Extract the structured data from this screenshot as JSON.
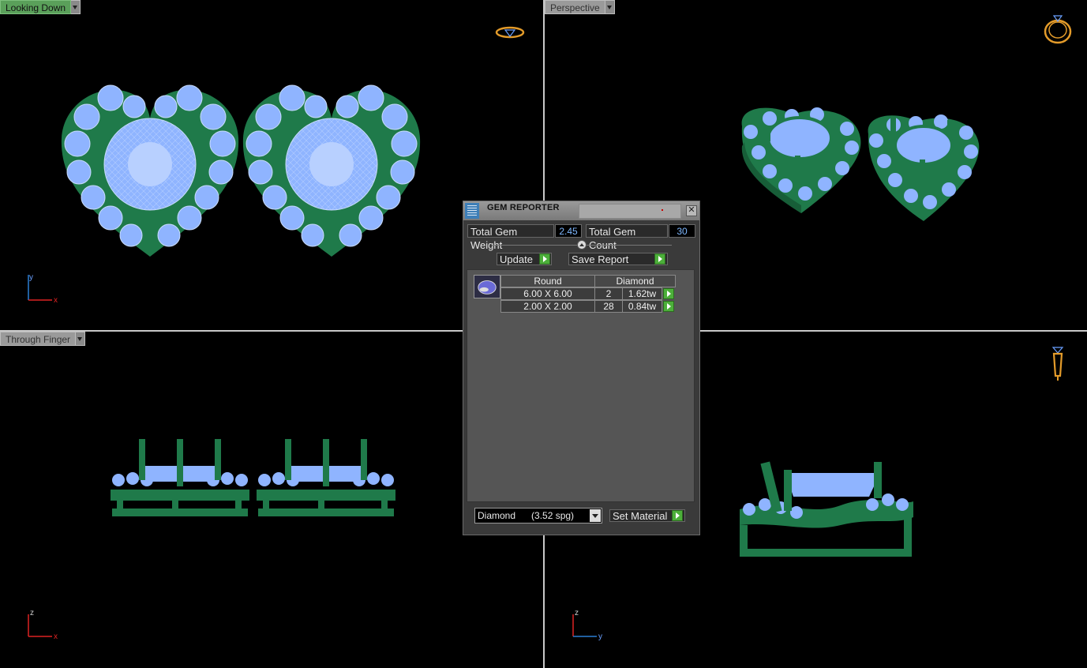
{
  "viewports": {
    "top_left": {
      "label": "Looking Down",
      "axis": {
        "v": "y",
        "h": "x"
      },
      "icon": "ring-top-view-icon"
    },
    "top_right": {
      "label": "Perspective",
      "icon": "ring-perspective-icon"
    },
    "bottom_left": {
      "label": "Through Finger",
      "axis": {
        "v": "z",
        "h": "x"
      }
    },
    "bottom_right": {
      "label": "",
      "axis": {
        "v": "z",
        "h": "y"
      },
      "icon": "ring-side-view-icon"
    }
  },
  "colors": {
    "metal": "#1f7a4a",
    "gem": "#8fb4ff",
    "active_tab": "#5aa05a",
    "axis_red": "#d22",
    "axis_blue": "#2a7fd4"
  },
  "gem_reporter": {
    "title": "GEM REPORTER",
    "close_glyph": "✕",
    "total_weight_label": "Total Gem Weight",
    "total_weight_value": "2.45",
    "total_count_label": "Total Gem Count",
    "total_count_value": "30",
    "update_label": "Update",
    "save_report_label": "Save Report",
    "table": {
      "shape_header": "Round",
      "material_header": "Diamond",
      "rows": [
        {
          "size": "6.00 X 6.00",
          "count": "2",
          "weight": "1.62tw"
        },
        {
          "size": "2.00 X 2.00",
          "count": "28",
          "weight": "0.84tw"
        }
      ]
    },
    "material_select": "Diamond      (3.52 spg)",
    "set_material_label": "Set Material"
  }
}
